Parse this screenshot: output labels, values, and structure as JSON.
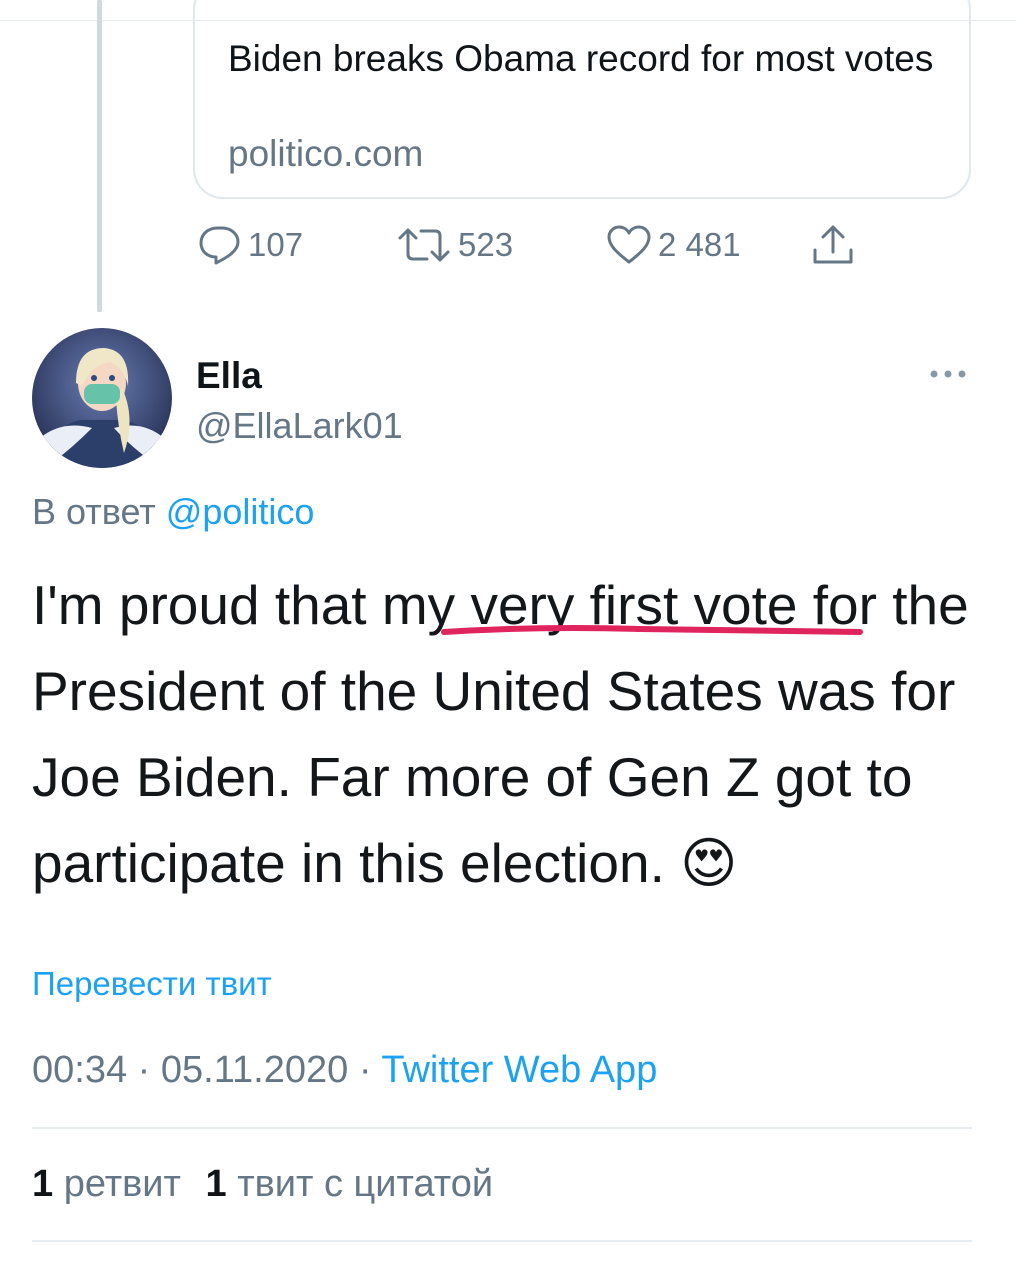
{
  "quoted_card": {
    "title": "Biden breaks Obama record for most votes",
    "domain": "politico.com"
  },
  "actions": {
    "replies": "107",
    "retweets": "523",
    "likes": "2 481"
  },
  "author": {
    "name": "Ella",
    "handle": "@EllaLark01"
  },
  "reply": {
    "prefix": "В ответ",
    "mention": "@politico"
  },
  "tweet": {
    "text": "I'm proud that my very first vote for the President of the United States was for Joe Biden. Far more of Gen Z got to participate in this election.",
    "emoji": "😍",
    "highlight_color": "#e0245e"
  },
  "translate_label": "Перевести твит",
  "meta": {
    "time": "00:34",
    "dot1": "·",
    "date": "05.11.2020",
    "dot2": "·",
    "source": "Twitter Web App"
  },
  "stats": {
    "retweets_count": "1",
    "retweets_label": "ретвит",
    "quotes_count": "1",
    "quotes_label": "твит с цитатой"
  },
  "icons": [
    "reply-icon",
    "retweet-icon",
    "like-icon",
    "share-icon",
    "more-icon"
  ],
  "colors": {
    "accent": "#1da1f2",
    "muted": "#657786",
    "border": "#e1e8ed"
  }
}
